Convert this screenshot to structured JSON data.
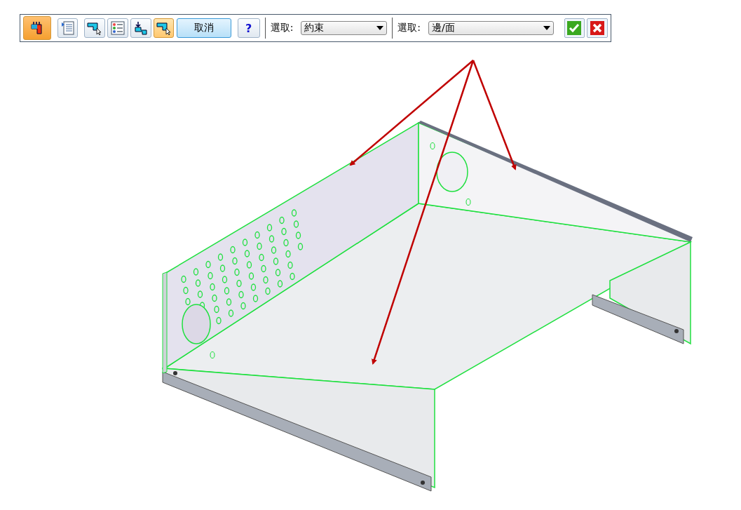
{
  "toolbar": {
    "tools": [
      {
        "kind": "main",
        "selected": true
      },
      {
        "kind": "list",
        "selected": false
      },
      {
        "kind": "select-shape",
        "selected": false
      },
      {
        "kind": "steps",
        "selected": false
      },
      {
        "kind": "place-shape",
        "selected": false
      },
      {
        "kind": "select-shape",
        "selected": true
      }
    ],
    "cancel_button": "取消",
    "help_button": "?",
    "selects": [
      {
        "label": "選取:",
        "value": "約束"
      },
      {
        "label": "選取:",
        "value": "邊/面"
      }
    ],
    "confirm_buttons": [
      {
        "kind": "accept"
      },
      {
        "kind": "reject"
      }
    ]
  }
}
